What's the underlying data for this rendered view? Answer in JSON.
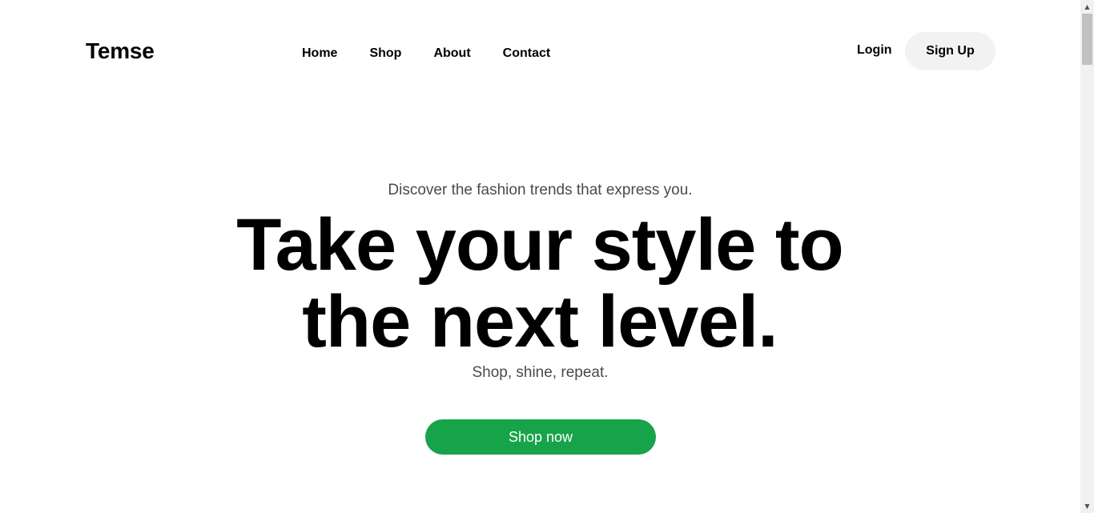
{
  "header": {
    "logo": "Temse",
    "nav": [
      {
        "label": "Home"
      },
      {
        "label": "Shop"
      },
      {
        "label": "About"
      },
      {
        "label": "Contact"
      }
    ],
    "login_label": "Login",
    "signup_label": "Sign Up"
  },
  "hero": {
    "subtitle": "Discover the fashion trends that express you.",
    "title": "Take your style to the next level.",
    "tagline": "Shop, shine, repeat.",
    "cta_label": "Shop now"
  },
  "colors": {
    "accent": "#17a34a",
    "signup_bg": "#f2f2f2",
    "muted_text": "#4a4a4a"
  },
  "scrollbar": {
    "up_icon": "chevron-up-icon",
    "down_icon": "chevron-down-icon"
  }
}
